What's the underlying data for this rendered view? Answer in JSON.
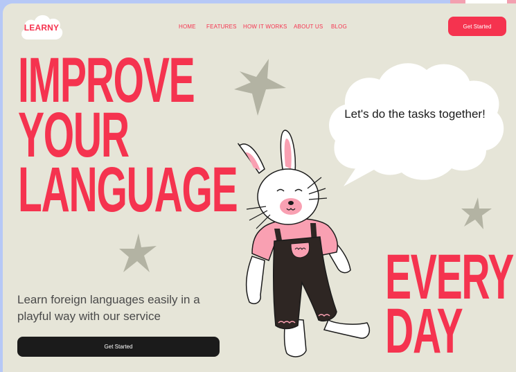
{
  "brand": {
    "logo_text": "LEARNY"
  },
  "nav": {
    "items": [
      "HOME",
      "FEATURES",
      "HOW IT WORKS",
      "ABOUT US",
      "BLOG"
    ],
    "cta_label": "Get Started"
  },
  "hero": {
    "headline_lines": [
      "IMPROVE",
      "YOUR",
      "LANGUAGE"
    ],
    "tagline": "Learn foreign languages easily in a playful way with our service",
    "cta_label": "Get Started",
    "speech_bubble": "Let's do the tasks together!",
    "side_headline_lines": [
      "EVERY",
      "DAY"
    ]
  },
  "colors": {
    "accent": "#f5334f",
    "background": "#e6e5d8",
    "dark": "#1b1b1b",
    "star": "#b3b3a3",
    "pink": "#f9a0b2"
  },
  "icons": [
    "star-icon",
    "cloud-icon",
    "bunny-illustration"
  ]
}
